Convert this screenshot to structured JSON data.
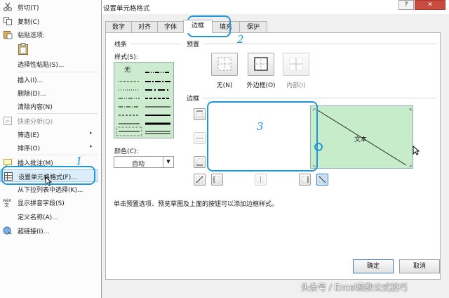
{
  "context_menu": {
    "items": [
      {
        "label": "剪切(T)",
        "icon": "scissors-icon"
      },
      {
        "label": "复制(C)",
        "icon": "copy-icon"
      },
      {
        "label": "粘贴选项:",
        "icon": "paste-icon"
      },
      {
        "label": "选择性粘贴(S)..."
      },
      {
        "label": "插入(I)..."
      },
      {
        "label": "删除(D)..."
      },
      {
        "label": "清除内容(N)"
      },
      {
        "label": "快速分析(Q)",
        "icon": "quick-analysis-icon"
      },
      {
        "label": "筛选(E)"
      },
      {
        "label": "排序(O)"
      },
      {
        "label": "插入批注(M)",
        "icon": "comment-icon"
      },
      {
        "label": "设置单元格格式(F)...",
        "icon": "format-cells-icon"
      },
      {
        "label": "从下拉列表中选择(K)..."
      },
      {
        "label": "显示拼音字段(S)",
        "icon": "phonetic-icon"
      },
      {
        "label": "定义名称(A)..."
      },
      {
        "label": "超链接(I)...",
        "icon": "hyperlink-icon"
      }
    ],
    "submenu_arrow": "▸"
  },
  "dialog": {
    "title": "设置单元格格式",
    "help": "?",
    "close": "✕",
    "tabs": [
      "数字",
      "对齐",
      "字体",
      "边框",
      "填充",
      "保护"
    ],
    "active_tab": "边框",
    "line_group": "线条",
    "style_label": "样式(S):",
    "style_none": "无",
    "color_label": "颜色(C):",
    "color_value": "自动",
    "presets_label": "预置",
    "presets": [
      "无(N)",
      "外边框(O)",
      "内部(I)"
    ],
    "border_label": "边框",
    "preview_text": "文本",
    "hint": "单击预置选项、预览草图及上面的按钮可以添加边框样式。",
    "ok": "确定",
    "cancel": "取消"
  },
  "annotations": {
    "n1": "1",
    "n2": "2",
    "n3": "3"
  },
  "watermark": "头条号 / Excel函数公式技巧",
  "colors": {
    "highlight": "#1f97d8",
    "preview_fill": "#c7ecc9",
    "close_button": "#c94a3f"
  }
}
